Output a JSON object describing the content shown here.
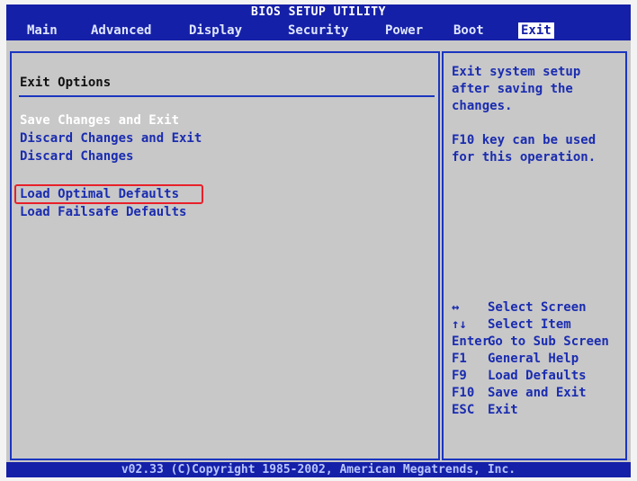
{
  "title": "BIOS SETUP UTILITY",
  "menu": [
    {
      "label": "Main"
    },
    {
      "label": "Advanced"
    },
    {
      "label": "Display"
    },
    {
      "label": "Security"
    },
    {
      "label": "Power"
    },
    {
      "label": "Boot"
    },
    {
      "label": "Exit"
    }
  ],
  "active_tab": "Exit",
  "main": {
    "section_title": "Exit Options",
    "options": [
      {
        "label": "Save Changes and Exit"
      },
      {
        "label": "Discard Changes and Exit"
      },
      {
        "label": "Discard Changes"
      },
      {
        "label": "Load Optimal Defaults"
      },
      {
        "label": "Load Failsafe Defaults"
      }
    ],
    "selected_option": "Save Changes and Exit",
    "highlighted_option": "Load Optimal Defaults"
  },
  "help": {
    "description": [
      "Exit system setup",
      "after saving the",
      "changes."
    ],
    "note": [
      "F10 key can be used",
      "for this operation."
    ]
  },
  "keys": [
    {
      "key": "↔",
      "desc": "Select Screen"
    },
    {
      "key": "↑↓",
      "desc": "Select Item"
    },
    {
      "key": "Enter",
      "desc": "Go to Sub Screen"
    },
    {
      "key": "F1",
      "desc": "General Help"
    },
    {
      "key": "F9",
      "desc": "Load Defaults"
    },
    {
      "key": "F10",
      "desc": "Save and Exit"
    },
    {
      "key": "ESC",
      "desc": "Exit"
    }
  ],
  "footer": "v02.33 (C)Copyright 1985-2002, American Megatrends, Inc.",
  "colors": {
    "bar_background": "#1520a8",
    "panel_background": "#c8c8c8",
    "text_blue": "#1a2cb0",
    "selected_text": "#ffffff",
    "highlight_outline": "#e8202a"
  }
}
